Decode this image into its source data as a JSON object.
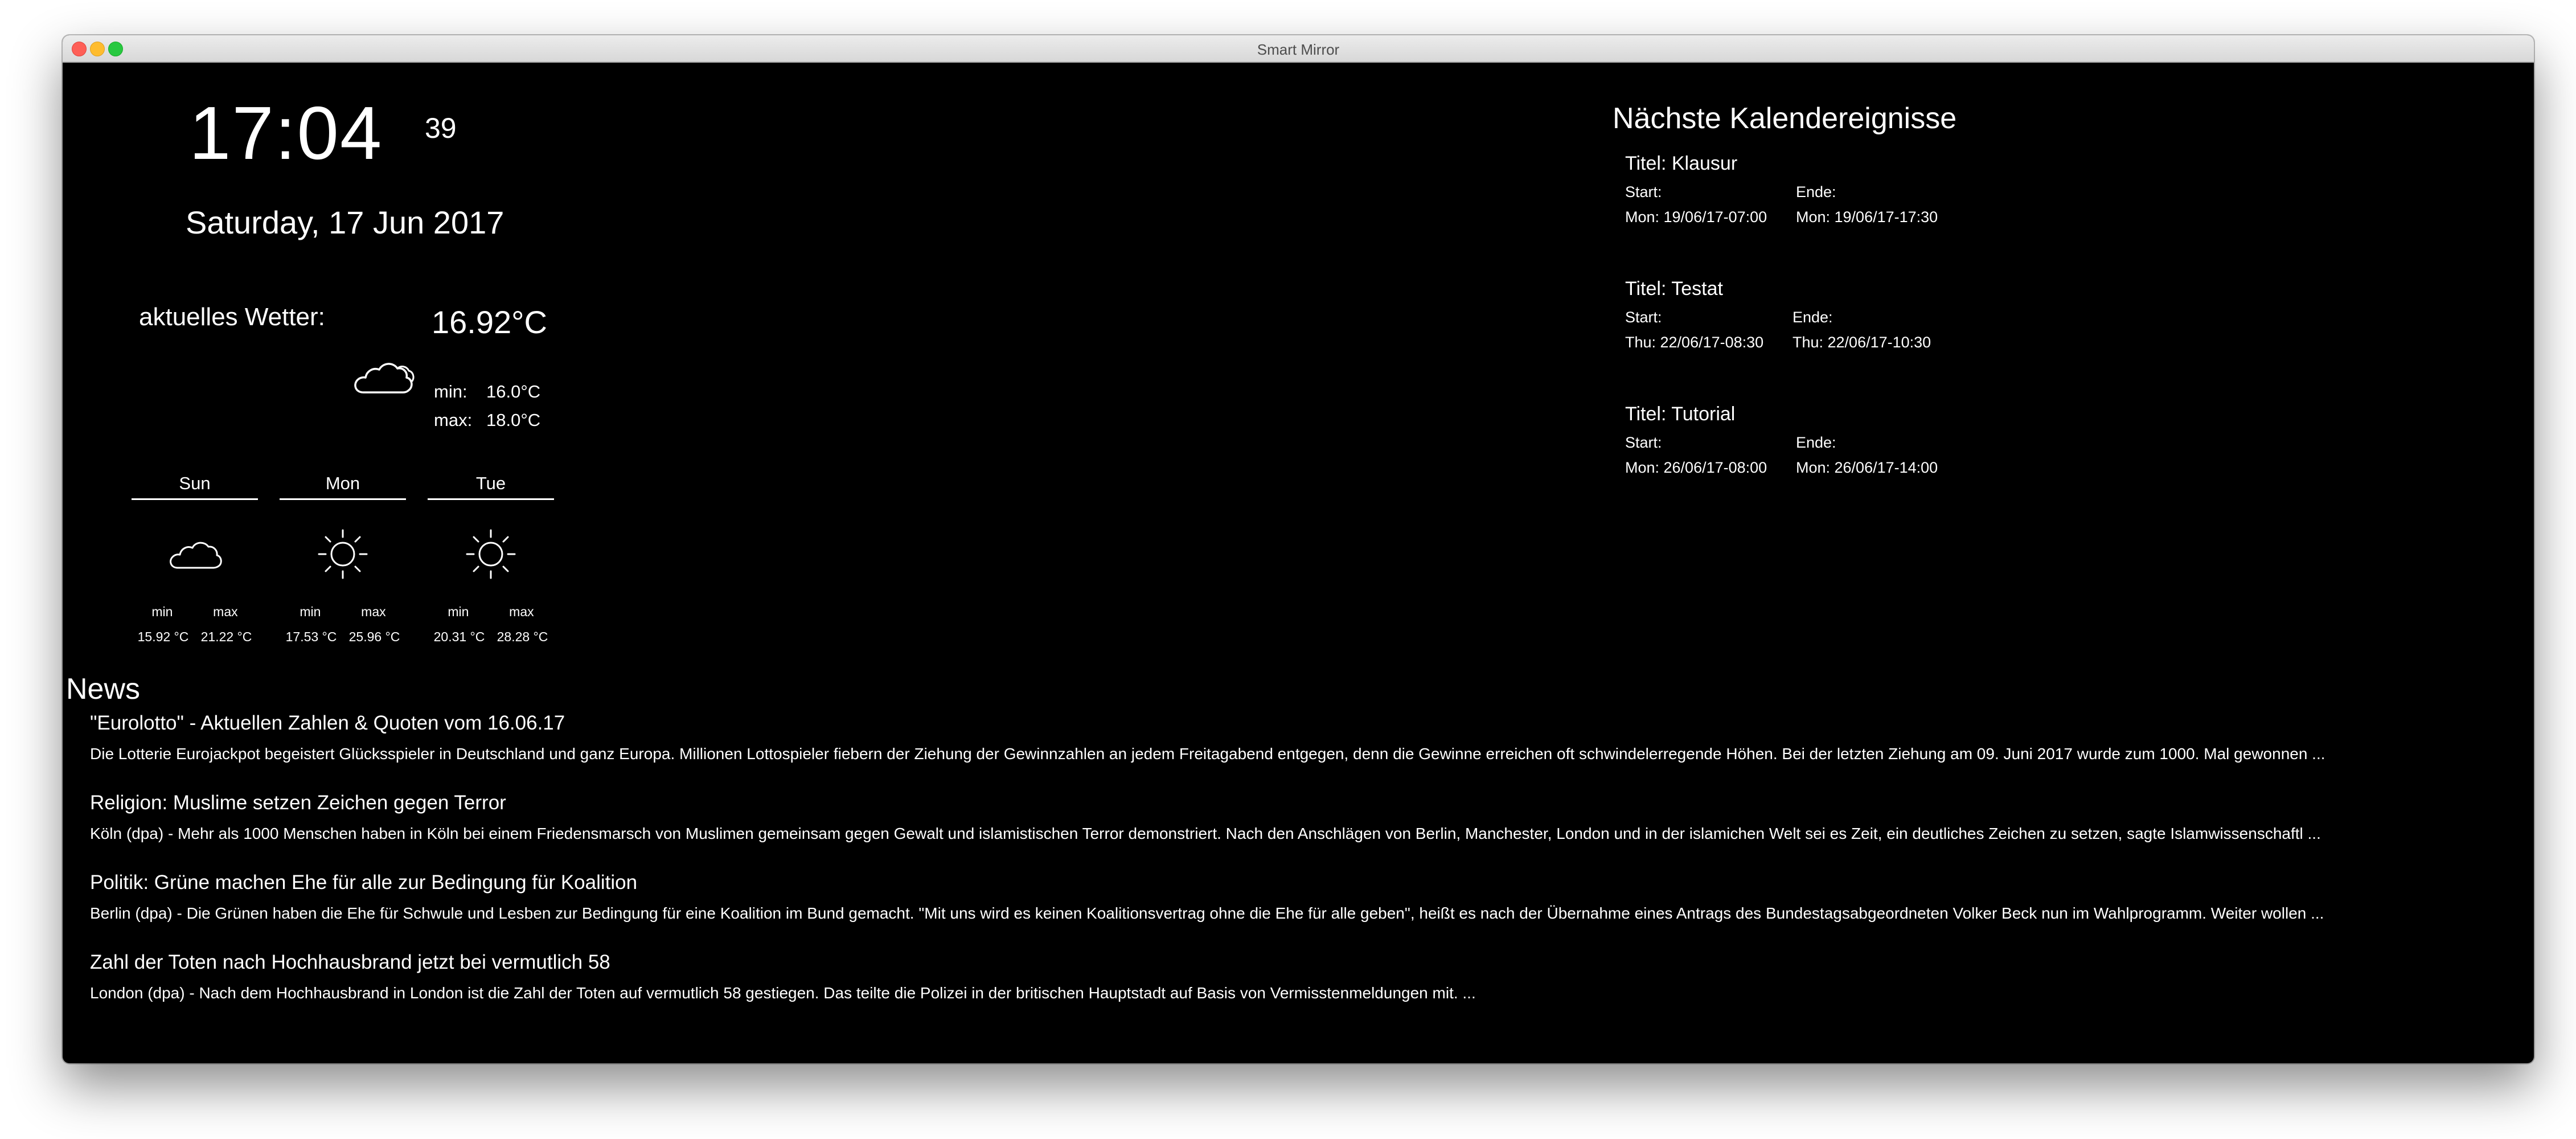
{
  "window": {
    "title": "Smart Mirror"
  },
  "clock": {
    "time": "17:04",
    "seconds": "39",
    "date": "Saturday, 17 Jun 2017"
  },
  "weather": {
    "label": "aktuelles Wetter:",
    "icon": "cloud-icon",
    "temperature": "16.92°C",
    "min_label": "min:",
    "min_value": "16.0°C",
    "max_label": "max:",
    "max_value": "18.0°C"
  },
  "forecast": [
    {
      "day": "Sun",
      "icon": "cloud-icon",
      "min_label": "min",
      "max_label": "max",
      "min": "15.92 °C",
      "max": "21.22 °C"
    },
    {
      "day": "Mon",
      "icon": "sun-icon",
      "min_label": "min",
      "max_label": "max",
      "min": "17.53 °C",
      "max": "25.96 °C"
    },
    {
      "day": "Tue",
      "icon": "sun-icon",
      "min_label": "min",
      "max_label": "max",
      "min": "20.31 °C",
      "max": "28.28 °C"
    }
  ],
  "calendar": {
    "heading": "Nächste Kalendereignisse",
    "events": [
      {
        "title": "Titel: Klausur",
        "start_label": "Start:",
        "end_label": "Ende:",
        "start": "Mon: 19/06/17-07:00",
        "end": "Mon: 19/06/17-17:30"
      },
      {
        "title": "Titel: Testat",
        "start_label": "Start:",
        "end_label": "Ende:",
        "start": "Thu: 22/06/17-08:30",
        "end": "Thu: 22/06/17-10:30"
      },
      {
        "title": "Titel: Tutorial",
        "start_label": "Start:",
        "end_label": "Ende:",
        "start": "Mon: 26/06/17-08:00",
        "end": "Mon: 26/06/17-14:00"
      }
    ]
  },
  "news": {
    "heading": "News",
    "items": [
      {
        "title": "\"Eurolotto\" - Aktuellen Zahlen & Quoten vom 16.06.17",
        "text": "Die Lotterie Eurojackpot begeistert Glücksspieler in Deutschland und ganz Europa. Millionen Lottospieler fiebern der Ziehung der Gewinnzahlen an jedem Freitagabend entgegen,  denn die Gewinne erreichen oft schwindelerregende Höhen. Bei der letzten Ziehung am 09. Juni 2017 wurde zum 1000. Mal gewonnen ..."
      },
      {
        "title": "Religion: Muslime setzen Zeichen gegen Terror",
        "text": "Köln (dpa) - Mehr als 1000 Menschen haben in Köln bei einem Friedensmarsch von Muslimen gemeinsam gegen Gewalt und islamistischen Terror demonstriert. Nach den Anschlägen von Berlin,  Manchester,  London und in der islamichen Welt sei es Zeit,  ein deutliches Zeichen zu setzen,  sagte Islamwissenschaftl ..."
      },
      {
        "title": "Politik: Grüne machen Ehe für alle zur Bedingung für Koalition",
        "text": "Berlin (dpa) - Die Grünen haben die Ehe für Schwule und Lesben zur Bedingung für eine Koalition im Bund gemacht. \"Mit uns wird es keinen Koalitionsvertrag ohne die Ehe für alle geben\",  heißt es nach der Übernahme eines Antrags des Bundestagsabgeordneten Volker Beck nun im Wahlprogramm. Weiter wollen ..."
      },
      {
        "title": "Zahl der Toten nach Hochhausbrand jetzt bei vermutlich 58",
        "text": "London (dpa) - Nach dem Hochhausbrand in London ist die Zahl der Toten auf vermutlich 58 gestiegen. Das teilte die Polizei in der britischen Hauptstadt auf Basis von Vermisstenmeldungen mit. ..."
      }
    ]
  }
}
